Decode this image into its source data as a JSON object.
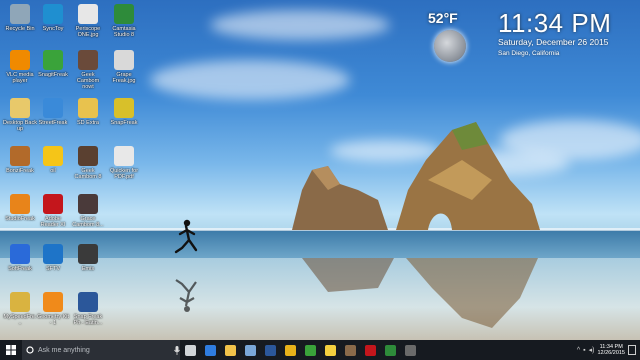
{
  "desktop_icons": [
    {
      "label": "Recycle Bin",
      "icon": "recycle-bin-icon",
      "color": "#8fa6b8"
    },
    {
      "label": "SyncToy",
      "icon": "synctoy-icon",
      "color": "#1f8fd0"
    },
    {
      "label": "Periscope ONE.jpg",
      "icon": "image-file-icon",
      "color": "#e7e7e7"
    },
    {
      "label": "Camtasia Studio 8",
      "icon": "camtasia-icon",
      "color": "#2e8b3a"
    },
    {
      "label": "VLC media player",
      "icon": "vlc-icon",
      "color": "#f08a00"
    },
    {
      "label": "SnagitFreak",
      "icon": "snagit-icon",
      "color": "#3aa33a"
    },
    {
      "label": "Geek Cambom nowt",
      "icon": "photo-icon",
      "color": "#6a4a3a"
    },
    {
      "label": "Grape Freak.jpg",
      "icon": "image-file-icon",
      "color": "#d9d9d9"
    },
    {
      "label": "Desktop Back up",
      "icon": "doc-icon",
      "color": "#e8c96a"
    },
    {
      "label": "StreetFreak",
      "icon": "app-icon",
      "color": "#3a8ad9"
    },
    {
      "label": "SD Extra",
      "icon": "folder-icon",
      "color": "#e8c24e"
    },
    {
      "label": "SnapFreak",
      "icon": "app-icon",
      "color": "#d8c02a"
    },
    {
      "label": "BonziFreak",
      "icon": "monkey-icon",
      "color": "#b26a2a"
    },
    {
      "label": "oil",
      "icon": "smiley-icon",
      "color": "#f5c518"
    },
    {
      "label": "Geek Cambom 8",
      "icon": "photo-icon",
      "color": "#5a4030"
    },
    {
      "label": "Quicken for PDF.pdf",
      "icon": "pdf-icon",
      "color": "#e8e8e8"
    },
    {
      "label": "StudioFreak",
      "icon": "flower-icon",
      "color": "#e8841a"
    },
    {
      "label": "Adobe Reader XI",
      "icon": "adobe-reader-icon",
      "color": "#c4161c"
    },
    {
      "label": "Grace Cambom 8...",
      "icon": "photo-icon",
      "color": "#4a3a3a"
    },
    {
      "label": "SoftFreak",
      "icon": "app-icon",
      "color": "#2a6ad9"
    },
    {
      "label": "SFTV",
      "icon": "blue-disc-icon",
      "color": "#1e74c8"
    },
    {
      "label": "Emis",
      "icon": "photo-icon",
      "color": "#3a3a3a"
    },
    {
      "label": "MySpeedFre...",
      "icon": "folder-icon",
      "color": "#d9b340"
    },
    {
      "label": "Geometry Kit - 1",
      "icon": "ki-icon",
      "color": "#f08a1a"
    },
    {
      "label": "Snap Freak Ph - Eatin...",
      "icon": "word-doc-icon",
      "color": "#2b579a"
    }
  ],
  "weather": {
    "temperature": "52°F"
  },
  "clock": {
    "time": "11:34 PM",
    "date": "Saturday, December 26 2015",
    "location": "San Diego, California"
  },
  "taskbar": {
    "search_placeholder": "Ask me anything",
    "apps": [
      {
        "icon": "task-view-icon",
        "color": "#d0d4d8"
      },
      {
        "icon": "edge-icon",
        "color": "#2f7de1"
      },
      {
        "icon": "file-explorer-icon",
        "color": "#f0c24a"
      },
      {
        "icon": "store-icon",
        "color": "#7aa7d9"
      },
      {
        "icon": "word-icon",
        "color": "#2b579a"
      },
      {
        "icon": "chrome-icon",
        "color": "#e8b21a"
      },
      {
        "icon": "snagit-icon",
        "color": "#3aa33a"
      },
      {
        "icon": "notes-icon",
        "color": "#f4d03f"
      },
      {
        "icon": "photos-icon",
        "color": "#8a6a4a"
      },
      {
        "icon": "acrobat-icon",
        "color": "#c4161c"
      },
      {
        "icon": "camtasia-icon",
        "color": "#2e8b3a"
      },
      {
        "icon": "calendar-icon",
        "color": "#6a6a6a"
      }
    ],
    "tray_time": "11:34 PM",
    "tray_date": "12/26/2015"
  }
}
